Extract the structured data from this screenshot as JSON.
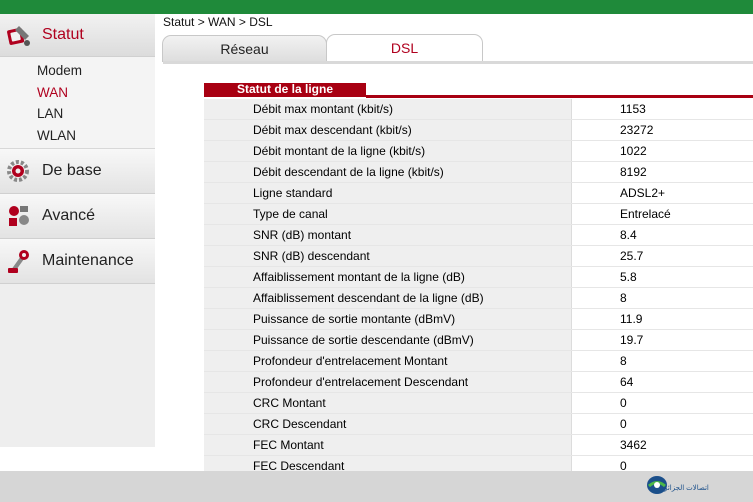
{
  "breadcrumb": "Statut > WAN > DSL",
  "sidebar": {
    "statut": {
      "label": "Statut",
      "icon": "status-icon"
    },
    "sub_items": [
      "Modem",
      "WAN",
      "LAN",
      "WLAN"
    ],
    "active_sub": "WAN",
    "de_base": {
      "label": "De base",
      "icon": "gear-icon"
    },
    "avance": {
      "label": "Avancé",
      "icon": "tools-icon"
    },
    "maintenance": {
      "label": "Maintenance",
      "icon": "maintenance-icon"
    }
  },
  "tabs": [
    {
      "label": "Réseau",
      "active": false
    },
    {
      "label": "DSL",
      "active": true
    }
  ],
  "section_title": "Statut de la ligne",
  "rows": [
    {
      "label": "Débit max montant (kbit/s)",
      "value": "1153"
    },
    {
      "label": "Débit max descendant (kbit/s)",
      "value": "23272"
    },
    {
      "label": "Débit montant de la ligne (kbit/s)",
      "value": "1022"
    },
    {
      "label": "Débit descendant de la ligne (kbit/s)",
      "value": "8192"
    },
    {
      "label": "Ligne standard",
      "value": "ADSL2+"
    },
    {
      "label": "Type de canal",
      "value": "Entrelacé"
    },
    {
      "label": "SNR (dB) montant",
      "value": "8.4"
    },
    {
      "label": "SNR (dB) descendant",
      "value": "25.7"
    },
    {
      "label": "Affaiblissement montant de la ligne (dB)",
      "value": "5.8"
    },
    {
      "label": "Affaiblissement descendant de la ligne (dB)",
      "value": "8"
    },
    {
      "label": "Puissance de sortie montante (dBmV)",
      "value": "11.9"
    },
    {
      "label": "Puissance de sortie descendante (dBmV)",
      "value": "19.7"
    },
    {
      "label": "Profondeur d'entrelacement Montant",
      "value": "8"
    },
    {
      "label": "Profondeur d'entrelacement Descendant",
      "value": "64"
    },
    {
      "label": "CRC Montant",
      "value": "0"
    },
    {
      "label": "CRC Descendant",
      "value": "0"
    },
    {
      "label": "FEC Montant",
      "value": "3462"
    },
    {
      "label": "FEC Descendant",
      "value": "0"
    }
  ],
  "footer": {
    "logo_text": "اتصالات الجزائر"
  },
  "colors": {
    "accent": "#a80012",
    "topbar": "#1f8a3a",
    "active_text": "#b0001e"
  }
}
